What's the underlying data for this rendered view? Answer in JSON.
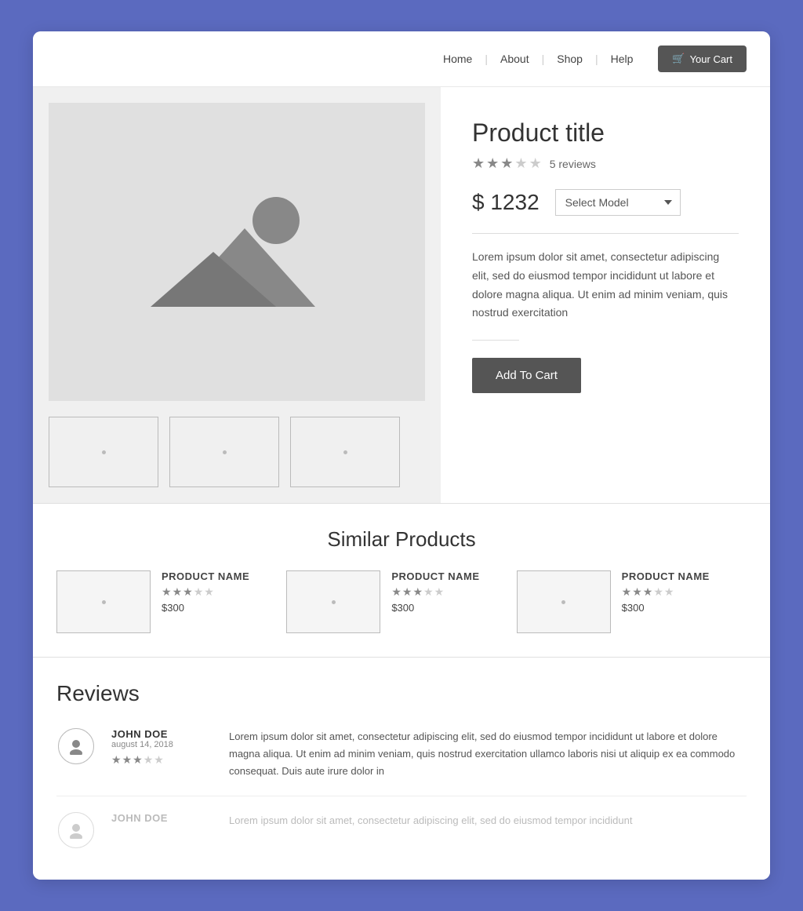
{
  "nav": {
    "links": [
      "Home",
      "About",
      "Shop",
      "Help"
    ],
    "cart_label": "Your Cart"
  },
  "product": {
    "title": "Product title",
    "rating": 3,
    "max_rating": 5,
    "review_count": "5 reviews",
    "price": "$ 1232",
    "select_placeholder": "Select Model",
    "description": "Lorem ipsum dolor sit amet, consectetur adipiscing elit, sed do eiusmod tempor incididunt ut labore et dolore magna aliqua. Ut enim ad minim veniam, quis nostrud exercitation",
    "add_to_cart": "Add To Cart"
  },
  "similar": {
    "title": "Similar Products",
    "items": [
      {
        "name": "PRODUCT NAME",
        "rating": 3,
        "price": "$300"
      },
      {
        "name": "PRODUCT NAME",
        "rating": 3,
        "price": "$300"
      },
      {
        "name": "PRODUCT NAME",
        "rating": 3,
        "price": "$300"
      }
    ]
  },
  "reviews": {
    "title": "Reviews",
    "items": [
      {
        "name": "JOHN DOE",
        "date": "august 14, 2018",
        "rating": 3,
        "text": "Lorem ipsum dolor sit amet, consectetur adipiscing elit, sed do eiusmod tempor incididunt ut labore et dolore magna aliqua. Ut enim ad minim veniam, quis nostrud exercitation ullamco laboris nisi ut aliquip ex ea commodo consequat. Duis aute irure dolor in"
      },
      {
        "name": "JOHN DOE",
        "date": "",
        "rating": 0,
        "text": "Lorem ipsum dolor sit amet, consectetur adipiscing elit, sed do eiusmod tempor incididunt"
      }
    ]
  }
}
